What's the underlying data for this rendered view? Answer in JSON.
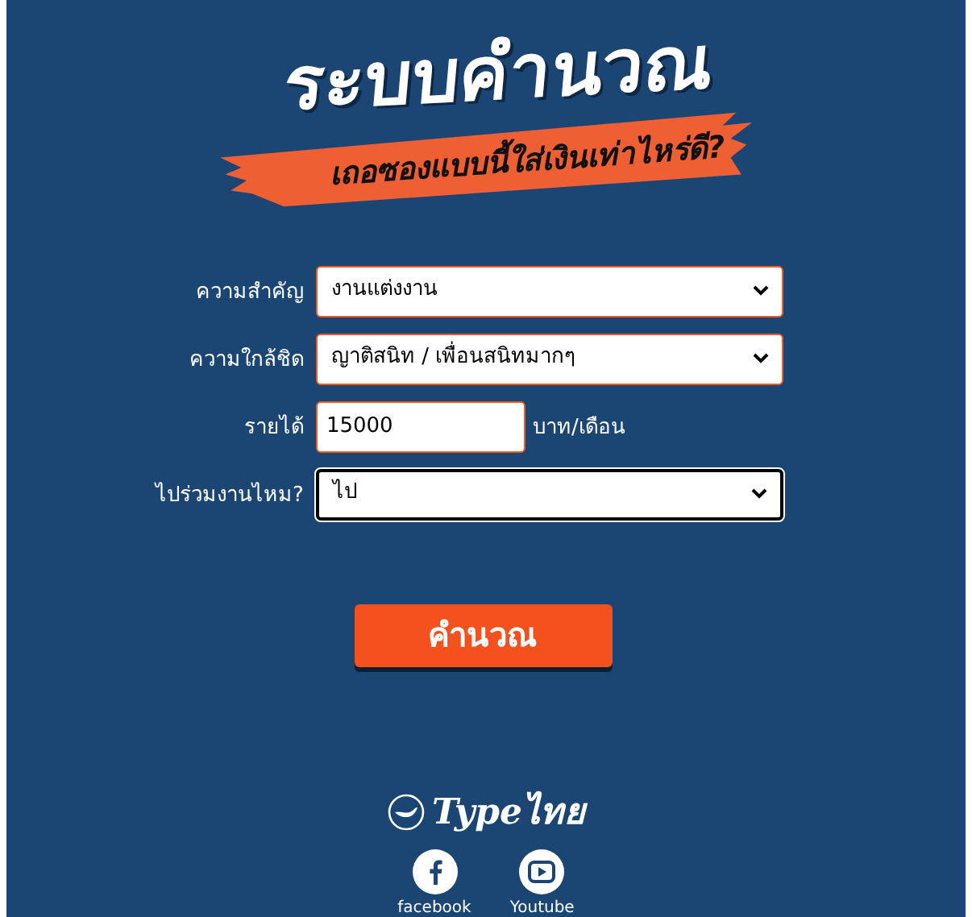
{
  "header": {
    "title": "ระบบคำนวณ",
    "subtitle": "เถอซองแบบนี้ใส่เงินเท่าไหร่ดี?"
  },
  "form": {
    "fields": [
      {
        "kind": "select",
        "label": "ความสำคัญ",
        "value": "งานแต่งงาน",
        "focused": false
      },
      {
        "kind": "select",
        "label": "ความใกล้ชิด",
        "value": "ญาติสนิท / เพื่อนสนิทมากๆ",
        "focused": false
      },
      {
        "kind": "input",
        "label": "รายได้",
        "value": "15000",
        "unit": "บาท/เดือน",
        "focused": false
      },
      {
        "kind": "select",
        "label": "ไปร่วมงานไหม?",
        "value": "ไป",
        "focused": true
      }
    ],
    "submit": "คำนวณ"
  },
  "footer": {
    "logo": "Typeไทย",
    "links": [
      {
        "kind": "facebook",
        "label": "facebook"
      },
      {
        "kind": "youtube",
        "label": "Youtube"
      }
    ]
  }
}
